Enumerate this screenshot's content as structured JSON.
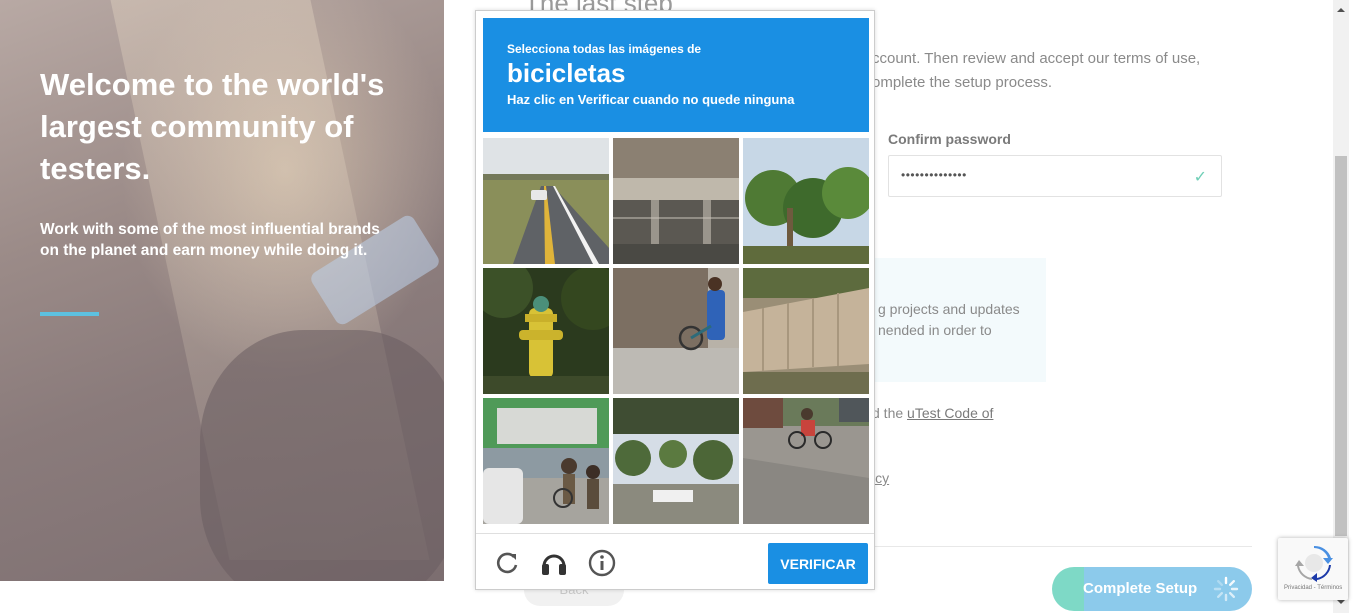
{
  "hero": {
    "title": "Welcome to the world's largest community of testers.",
    "subtitle": "Work with some of the most influential brands on the planet and earn money while doing it.",
    "accent_color": "#5dc1e0"
  },
  "form": {
    "title": "The last step",
    "intro": "ccount. Then review and accept our terms of use, omplete the setup process.",
    "confirm_password_label": "Confirm password",
    "confirm_password_value": "••••••••••••••",
    "info_text": "g projects and updates nended in order to",
    "code_text_prefix": "d the ",
    "code_link": "uTest Code of",
    "privacy_text": "icy",
    "back_label": "Back",
    "complete_label": "Complete Setup",
    "complete_progress": 0.16,
    "complete_color": "#8ccaeb",
    "progress_color": "#7ed9c6"
  },
  "captcha": {
    "instruction": "Selecciona todas las imágenes de",
    "target": "bicicletas",
    "hint": "Haz clic en Verificar cuando no quede ninguna",
    "verify_label": "VERIFICAR",
    "accent_color": "#1a8fe3",
    "tiles": [
      {
        "name": "road-with-car"
      },
      {
        "name": "parking-garage"
      },
      {
        "name": "palm-trees"
      },
      {
        "name": "fire-hydrant"
      },
      {
        "name": "person-with-bicycle"
      },
      {
        "name": "wall-fence"
      },
      {
        "name": "street-people-bicycle"
      },
      {
        "name": "park-trees"
      },
      {
        "name": "cyclist-street"
      }
    ],
    "footer_icons": [
      "reload-icon",
      "audio-icon",
      "info-icon"
    ]
  },
  "badge": {
    "text": "Privacidad - Términos"
  }
}
